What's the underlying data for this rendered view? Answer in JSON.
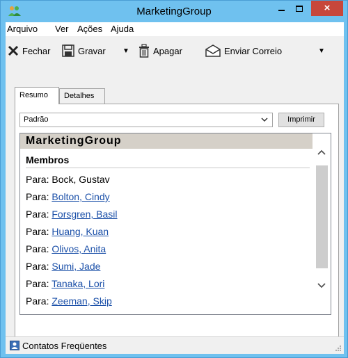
{
  "window": {
    "title": "MarketingGroup",
    "minimize_glyph": "",
    "close_glyph": "×"
  },
  "menu": [
    "Arquivo",
    "Ver",
    "Ações",
    "Ajuda"
  ],
  "toolbar": {
    "close_label": "Fechar",
    "save_label": "Gravar",
    "delete_label": "Apagar",
    "send_label": "Enviar Correio",
    "dropdown_glyph": "▼"
  },
  "tabs": [
    "Resumo",
    "Detalhes"
  ],
  "view_select": {
    "value": "Padrão"
  },
  "print_label": "Imprimir",
  "group": {
    "header": "MarketingGroup",
    "members_title": "Membros",
    "prefix": "Para: ",
    "members": [
      {
        "name": "Bock, Gustav",
        "link": false
      },
      {
        "name": "Bolton, Cindy",
        "link": true
      },
      {
        "name": "Forsgren, Basil",
        "link": true
      },
      {
        "name": "Huang, Kuan",
        "link": true
      },
      {
        "name": "Olivos, Anita",
        "link": true
      },
      {
        "name": "Sumi, Jade",
        "link": true
      },
      {
        "name": "Tanaka, Lori",
        "link": true
      },
      {
        "name": "Zeeman, Skip",
        "link": true
      }
    ]
  },
  "status": {
    "text": "Contatos Freqüentes"
  },
  "colors": {
    "frame": "#6fc1ef",
    "close": "#c7473b",
    "link": "#1a4fa8",
    "header_band": "#d5d0c8"
  }
}
